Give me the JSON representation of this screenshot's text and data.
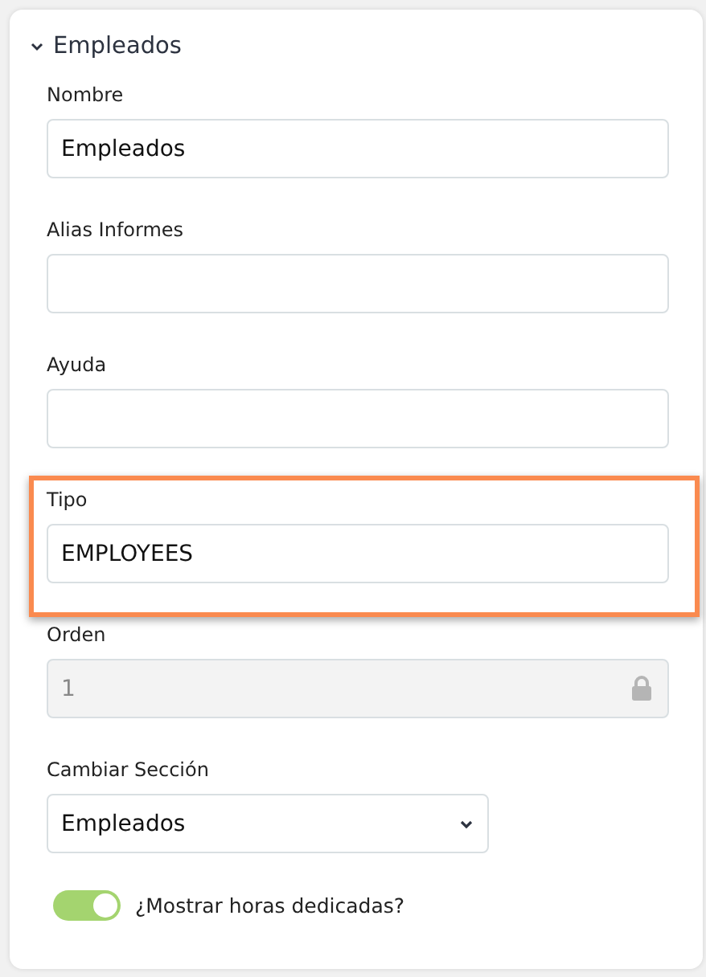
{
  "section": {
    "title": "Empleados",
    "expanded": true
  },
  "fields": [
    {
      "kind": "text",
      "label": "Nombre",
      "value": "Empleados",
      "highlighted": false
    },
    {
      "kind": "text",
      "label": "Alias Informes",
      "highlighted": false
    },
    {
      "kind": "text",
      "label": "Ayuda",
      "highlighted": false
    },
    {
      "kind": "text",
      "label": "Tipo",
      "value": "EMPLOYEES",
      "highlighted": true
    },
    {
      "kind": "locked",
      "label": "Orden",
      "value": "1",
      "highlighted": false
    },
    {
      "kind": "select",
      "label": "Cambiar Sección",
      "value": "Empleados",
      "highlighted": false
    }
  ],
  "toggle": {
    "label": "¿Mostrar horas dedicadas?",
    "on": true
  }
}
